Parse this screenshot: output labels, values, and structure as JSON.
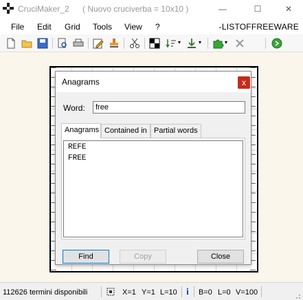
{
  "window": {
    "app_name": "CruciMaker_2",
    "document": "( Nuovo cruciverba =  10x10 )",
    "minimize_glyph": "—",
    "maximize_glyph": "☐",
    "close_glyph": "✕"
  },
  "menu": {
    "items": [
      "File",
      "Edit",
      "Grid",
      "Tools",
      "View",
      "?"
    ],
    "brand": "-LISTOFFREEWARE"
  },
  "toolbar": {
    "icons": [
      "new-file-icon",
      "open-folder-icon",
      "save-icon",
      "print-preview-icon",
      "print-icon",
      "edit-icon",
      "stamp-icon",
      "cut-icon",
      "checker-grid-icon",
      "sort-icon",
      "download-icon",
      "puzzle-icon",
      "delete-icon",
      "globe-icon"
    ]
  },
  "dialog": {
    "title": "Anagrams",
    "close_glyph": "x",
    "word_label": "Word:",
    "word_value": "free",
    "tabs": [
      "Anagrams",
      "Contained in",
      "Partial words"
    ],
    "active_tab": "Anagrams",
    "results": [
      "REFE",
      "FREE"
    ],
    "buttons": {
      "find": "Find",
      "copy": "Copy",
      "close": "Close"
    }
  },
  "status": {
    "terms": "112626 termini disponibili",
    "x": "X=1",
    "y": "Y=1",
    "l": "L=10",
    "info_glyph": "i",
    "b": "B=0",
    "l2": "L=0",
    "v": "V=100"
  },
  "colors": {
    "close_accent": "#c42b1c",
    "focus_accent": "#0078d7",
    "workspace": "#faf6ec"
  }
}
